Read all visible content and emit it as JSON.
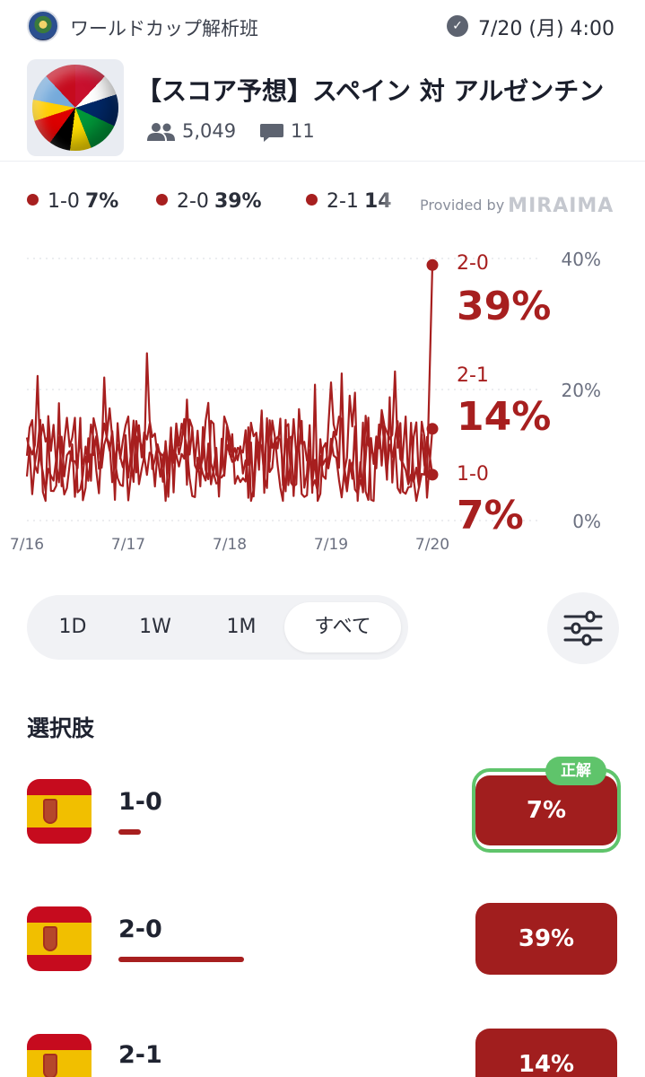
{
  "header": {
    "group_name": "ワールドカップ解析班",
    "datetime": "7/20 (月) 4:00",
    "verified_icon": "check-circle-icon"
  },
  "card": {
    "title": "【スコア予想】スペイン 対 アルゼンチン",
    "participants": "5,049",
    "comments": "11",
    "people_icon": "people-icon",
    "comment_icon": "comment-icon"
  },
  "legend": {
    "items": [
      {
        "label": "1-0",
        "value": "7%"
      },
      {
        "label": "2-0",
        "value": "39%"
      },
      {
        "label": "2-1",
        "value": "14"
      }
    ],
    "provided_by": "Provided by",
    "brand": "MIRAIMA"
  },
  "chart_data": {
    "type": "line",
    "x": [
      "7/16",
      "7/17",
      "7/18",
      "7/19",
      "7/20"
    ],
    "yticks": [
      "40%",
      "20%",
      "0%"
    ],
    "ylim": [
      0,
      40
    ],
    "color": "#a71f1f",
    "grid": true,
    "series": [
      {
        "name": "2-0",
        "final": "39%",
        "final_value": 39
      },
      {
        "name": "2-1",
        "final": "14%",
        "final_value": 14
      },
      {
        "name": "1-0",
        "final": "7%",
        "final_value": 7
      }
    ]
  },
  "range": {
    "tabs": [
      {
        "label": "1D",
        "active": false
      },
      {
        "label": "1W",
        "active": false
      },
      {
        "label": "1M",
        "active": false
      },
      {
        "label": "すべて",
        "active": true
      }
    ],
    "filter_icon": "sliders-icon"
  },
  "options": {
    "title": "選択肢",
    "correct_label": "正解",
    "items": [
      {
        "label": "1-0",
        "percent": "7%",
        "share": 0.07,
        "correct": true
      },
      {
        "label": "2-0",
        "percent": "39%",
        "share": 0.39,
        "correct": false
      },
      {
        "label": "2-1",
        "percent": "14%",
        "share": 0.14,
        "correct": false
      }
    ]
  }
}
